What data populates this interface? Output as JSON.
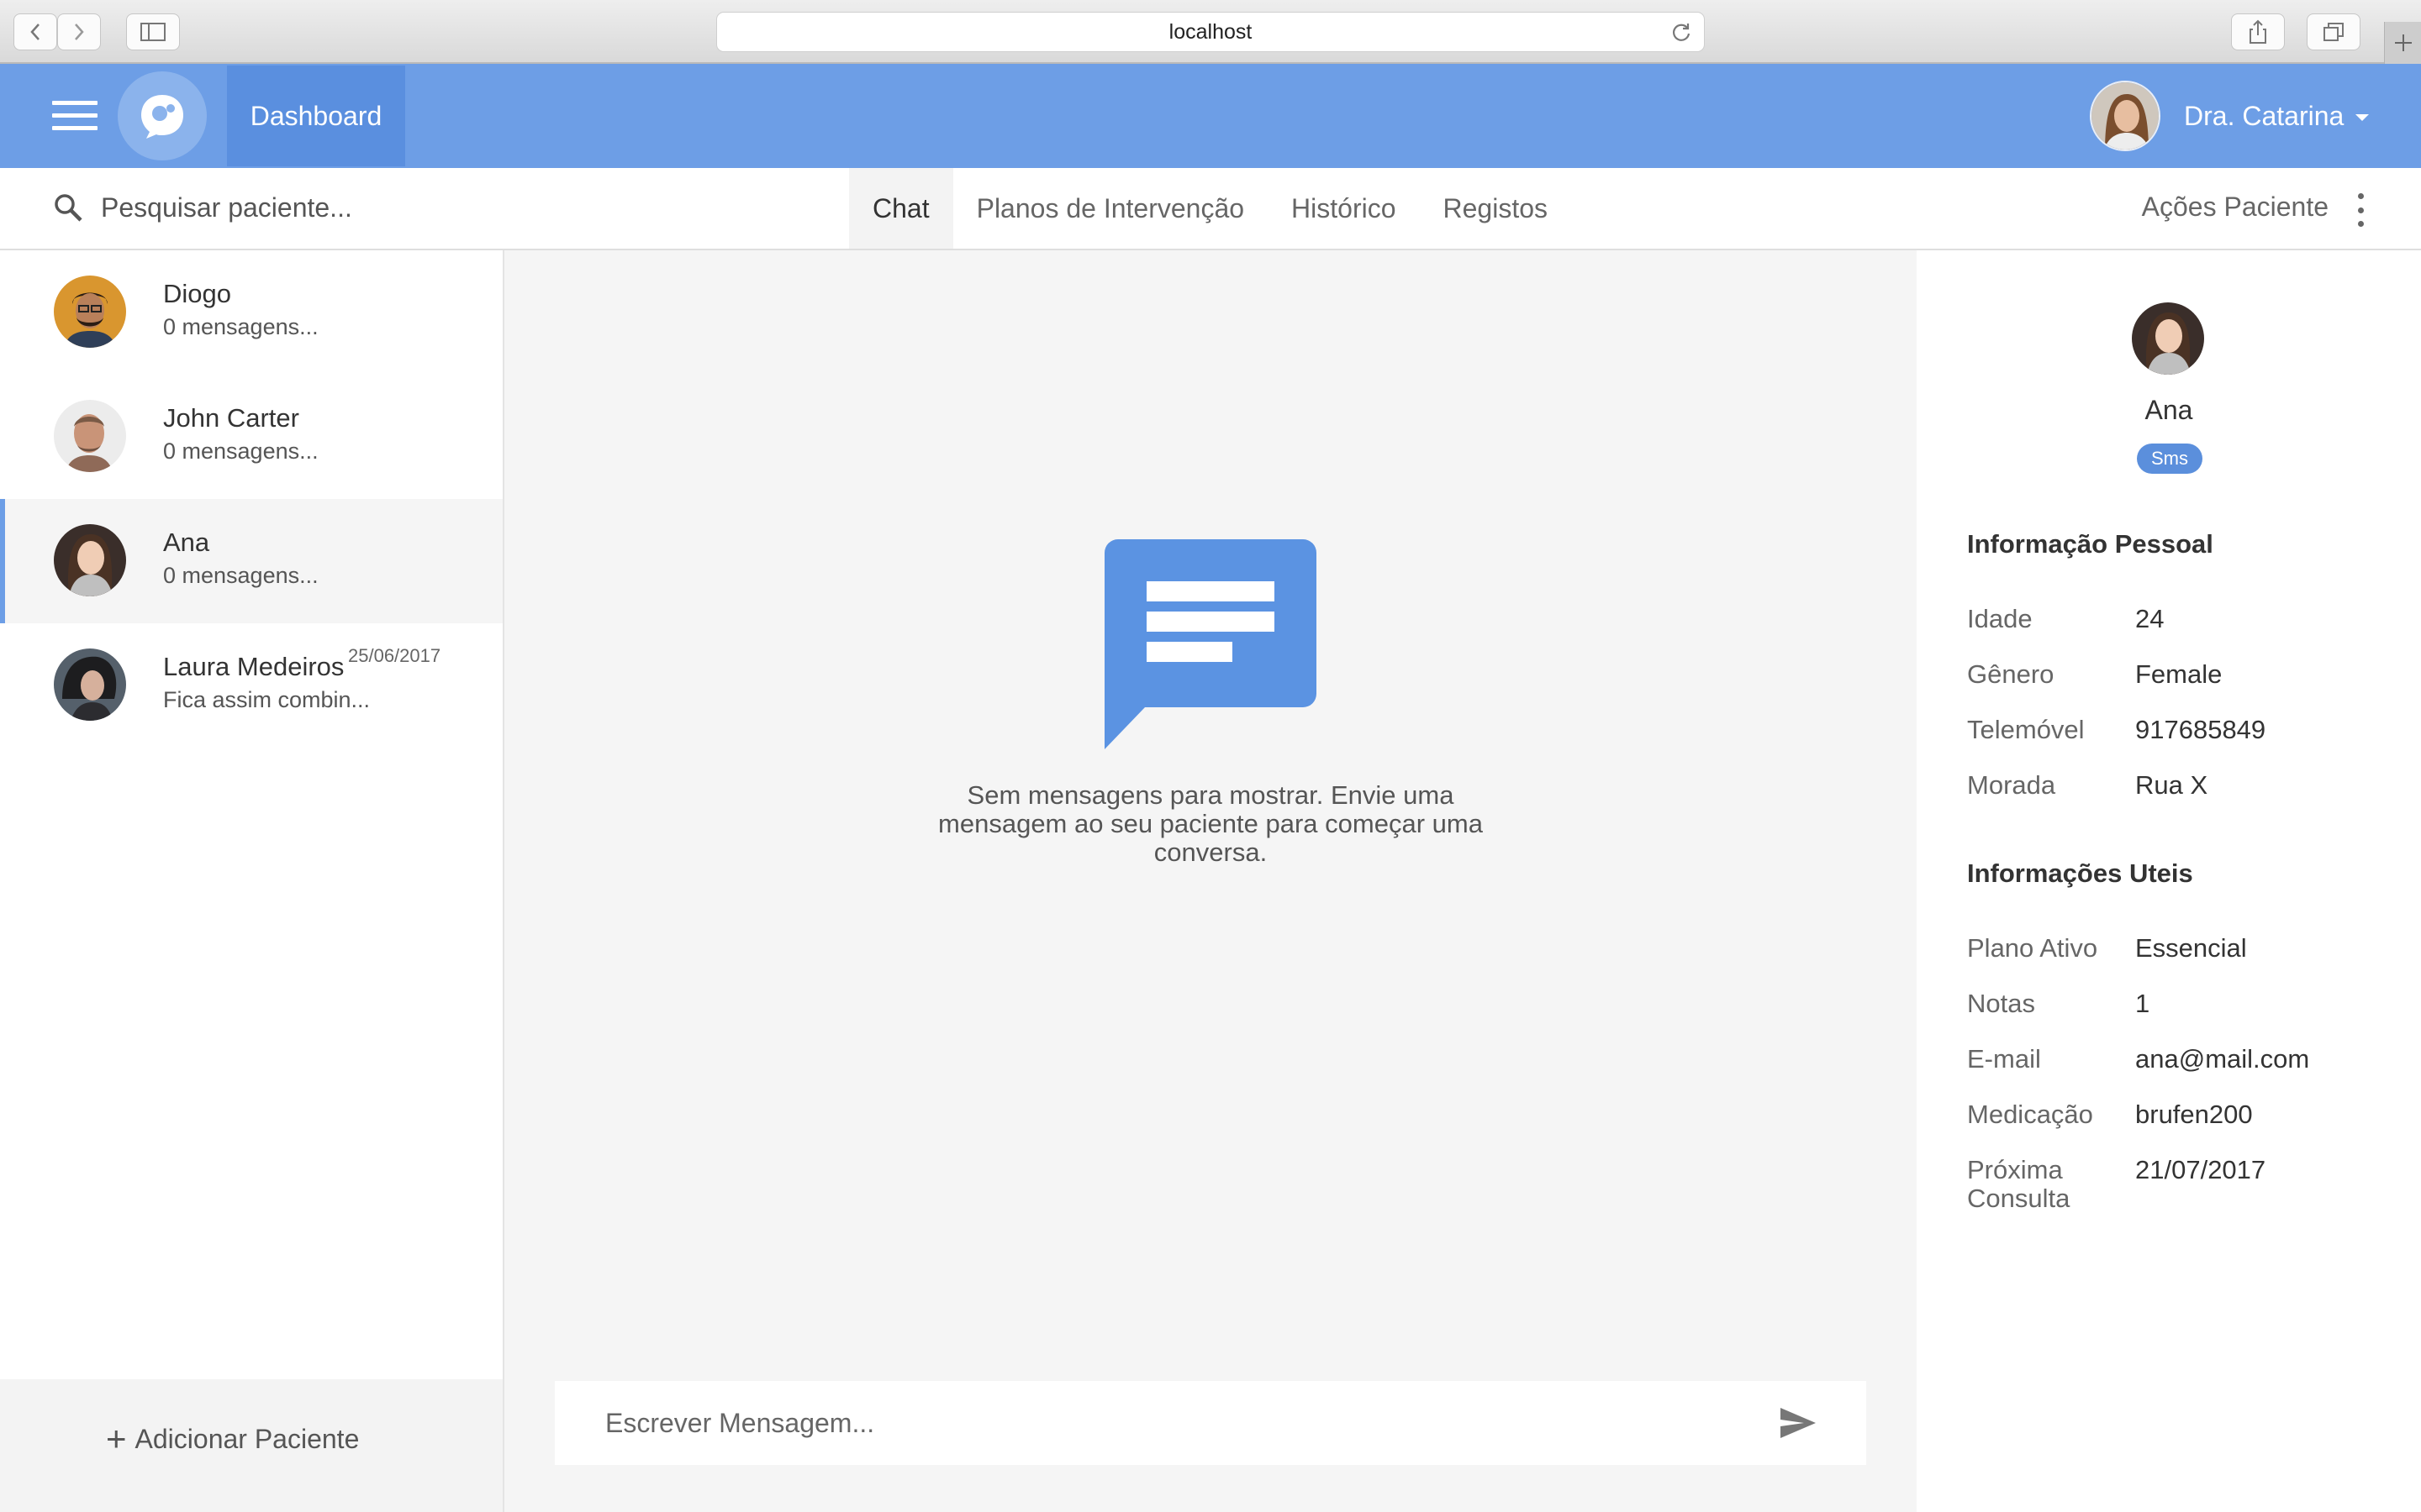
{
  "browser": {
    "url": "localhost"
  },
  "header": {
    "nav_tab": "Dashboard",
    "user_name": "Dra. Catarina"
  },
  "toolbar": {
    "search_placeholder": "Pesquisar paciente...",
    "tabs": [
      {
        "label": "Chat",
        "active": true
      },
      {
        "label": "Planos de Intervenção",
        "active": false
      },
      {
        "label": "Histórico",
        "active": false
      },
      {
        "label": "Registos",
        "active": false
      }
    ],
    "actions_label": "Ações Paciente"
  },
  "patients": [
    {
      "name": "Diogo",
      "preview": "0 mensagens...",
      "date": ""
    },
    {
      "name": "John Carter",
      "preview": "0 mensagens...",
      "date": ""
    },
    {
      "name": "Ana",
      "preview": "0 mensagens...",
      "date": "",
      "selected": true
    },
    {
      "name": "Laura Medeiros",
      "preview": "Fica assim combin...",
      "date": "25/06/2017"
    }
  ],
  "add_patient_label": "Adicionar Paciente",
  "chat": {
    "empty_message": "Sem mensagens para mostrar. Envie uma mensagem ao seu paciente para começar uma conversa.",
    "composer_placeholder": "Escrever Mensagem..."
  },
  "profile": {
    "name": "Ana",
    "badge": "Sms",
    "personal_title": "Informação Pessoal",
    "personal": [
      {
        "label": "Idade",
        "value": "24"
      },
      {
        "label": "Gênero",
        "value": "Female"
      },
      {
        "label": "Telemóvel",
        "value": "917685849"
      },
      {
        "label": "Morada",
        "value": "Rua X"
      }
    ],
    "useful_title": "Informações Uteis",
    "useful": [
      {
        "label": "Plano Ativo",
        "value": "Essencial"
      },
      {
        "label": "Notas",
        "value": "1"
      },
      {
        "label": "E-mail",
        "value": "ana@mail.com"
      },
      {
        "label": "Medicação",
        "value": "brufen200"
      },
      {
        "label": "Próxima Consulta",
        "value": "21/07/2017"
      }
    ]
  },
  "colors": {
    "header_blue": "#6d9ee6",
    "active_tab_blue": "#5a8fdf",
    "chat_icon_blue": "#5b93e2"
  }
}
